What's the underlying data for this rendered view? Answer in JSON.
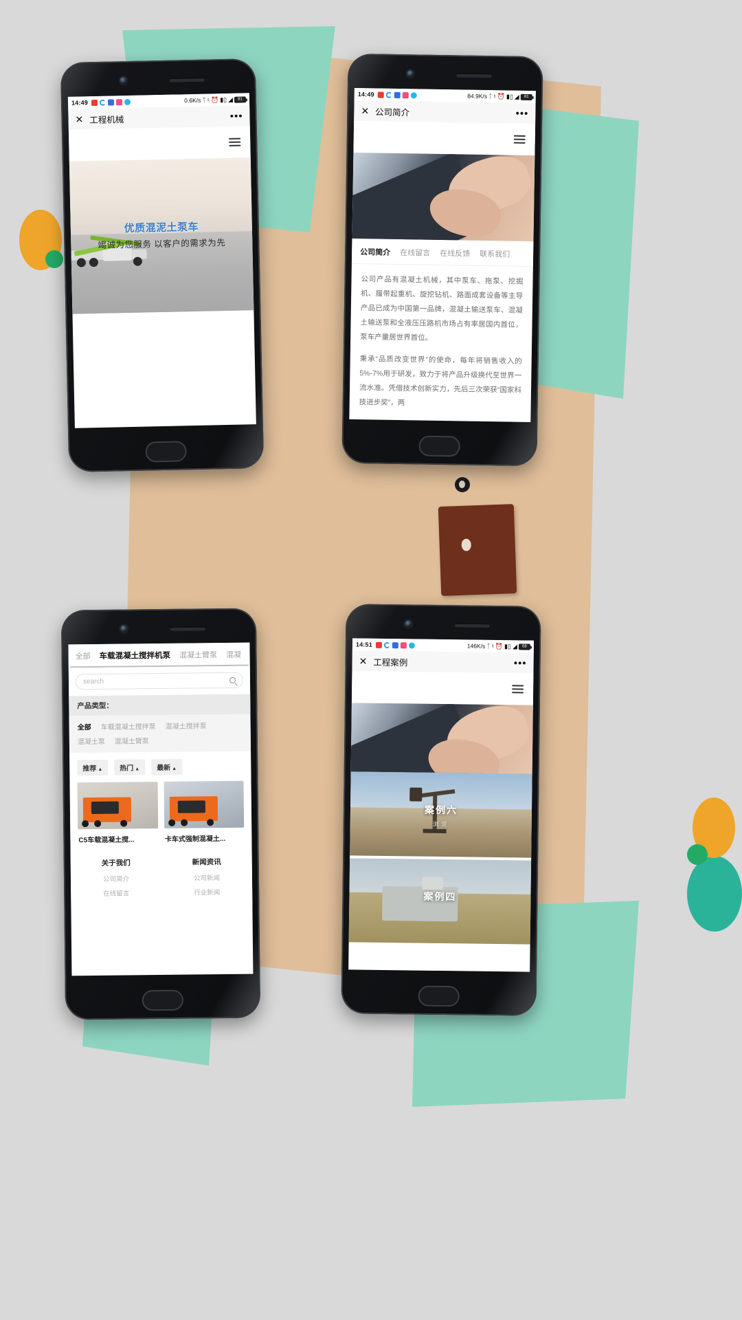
{
  "background": {
    "page_color": "#d9d9d9",
    "accent_tan": "#dfbe99",
    "accent_mint": "#8ed5c0",
    "accent_orange": "#eea52a",
    "accent_green": "#23ab66",
    "accent_teal": "#2bb39a",
    "accent_brown": "#6e2f1c"
  },
  "phone1": {
    "status": {
      "time": "14:49",
      "speed": "0.6K/s",
      "battery": "81"
    },
    "nav": {
      "close": "✕",
      "title": "工程机械",
      "more": "•••"
    },
    "hero": {
      "title": "优质混泥土泵车",
      "subtitle": "竭诚为您服务 以客户的需求为先"
    }
  },
  "phone2": {
    "status": {
      "time": "14:49",
      "speed": "84.9K/s",
      "battery": "81"
    },
    "nav": {
      "close": "✕",
      "title": "公司简介",
      "more": "•••"
    },
    "tabs": [
      {
        "label": "公司简介",
        "active": true
      },
      {
        "label": "在线留言",
        "active": false
      },
      {
        "label": "在线反馈",
        "active": false
      },
      {
        "label": "联系我们",
        "active": false
      }
    ],
    "paragraphs": [
      "公司产品有混凝土机械，其中泵车、拖泵、挖掘机、履带起重机、旋挖钻机、路面成套设备等主导产品已成为中国第一品牌，混凝土输送泵车、混凝土输送泵和全液压压路机市场占有率居国内首位，泵车产量居世界首位。",
      "秉承“品质改变世界”的使命，每年将销售收入的5%-7%用于研发，致力于将产品升级换代至世界一流水准。凭借技术创新实力，先后三次荣获“国家科技进步奖”，两"
    ]
  },
  "phone3": {
    "category_tabs": [
      {
        "label": "全部",
        "active": false
      },
      {
        "label": "车载混凝土搅拌机泵",
        "active": true
      },
      {
        "label": "混凝土臂泵",
        "active": false
      },
      {
        "label": "混凝",
        "active": false
      }
    ],
    "search": {
      "placeholder": "search",
      "icon": "search-icon"
    },
    "filter": {
      "heading": "产品类型：",
      "options": [
        {
          "label": "全部",
          "active": true
        },
        {
          "label": "车载混凝土搅拌泵",
          "active": false
        },
        {
          "label": "混凝土搅拌泵",
          "active": false
        },
        {
          "label": "混凝土泵",
          "active": false
        },
        {
          "label": "混凝土臂泵",
          "active": false
        }
      ]
    },
    "sorts": [
      {
        "label": "推荐",
        "caret": "▲"
      },
      {
        "label": "热门",
        "caret": "▲"
      },
      {
        "label": "最新",
        "caret": "▲"
      }
    ],
    "products": [
      {
        "title": "C5车载混凝土搅..."
      },
      {
        "title": "卡车式强制混凝土..."
      }
    ],
    "footer": [
      {
        "title": "关于我们",
        "links": [
          "公司简介",
          "在线留言"
        ]
      },
      {
        "title": "新闻资讯",
        "links": [
          "公司新闻",
          "行业新闻"
        ]
      }
    ]
  },
  "phone4": {
    "status": {
      "time": "14:51",
      "speed": "146K/s",
      "battery": "68"
    },
    "nav": {
      "close": "✕",
      "title": "工程案例",
      "more": "•••"
    },
    "cases": [
      {
        "label": "案例六",
        "sub": "浏览"
      },
      {
        "label": "案例四",
        "sub": ""
      }
    ]
  }
}
